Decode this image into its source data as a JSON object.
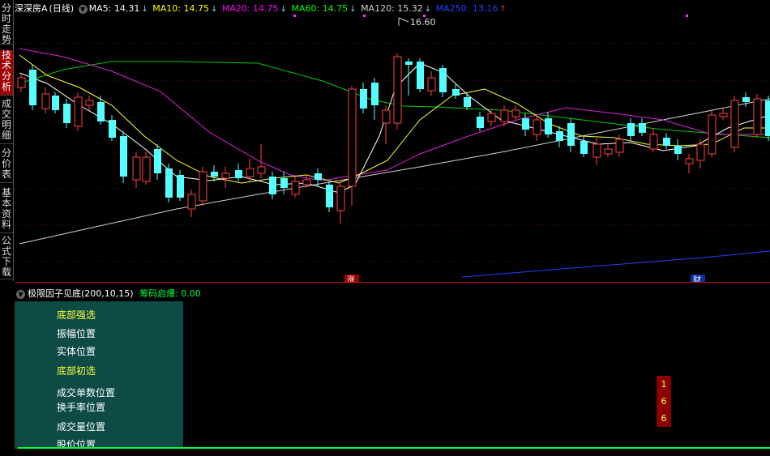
{
  "sidebar": {
    "tabs": [
      {
        "label": "分时走势",
        "active": false
      },
      {
        "label": "技术分析",
        "active": true
      },
      {
        "label": "成交明细",
        "active": false
      },
      {
        "label": "分价表",
        "active": false
      },
      {
        "label": "基本资料",
        "active": false
      },
      {
        "label": "公式下载",
        "active": false
      }
    ]
  },
  "header": {
    "stock": "深深房A",
    "period": "(日线)",
    "ma5": "MA5: 14.31",
    "ma10": "MA10: 14.75",
    "ma20": "MA20: 14.75",
    "ma60": "MA60: 14.75",
    "ma120": "MA120: 15.32",
    "ma250": "MA250: 13.16",
    "colors": {
      "ma5": "#ffffff",
      "ma10": "#ffff00",
      "ma20": "#ff00ff",
      "ma60": "#00ff00",
      "ma120": "#d0d0d0",
      "ma250": "#2040ff",
      "up_arrow": "#ff3030",
      "down_arrow": "#7fd4ff"
    }
  },
  "chart": {
    "high_label": "16.60",
    "marker_zhang": "涨",
    "marker_cai": "财"
  },
  "indicator": {
    "title": "极限因子见底(200,10,15)",
    "value_label": "筹码启爆: 0.00",
    "items": [
      {
        "label": "底部强选",
        "highlight": true
      },
      {
        "label": "振幅位置",
        "highlight": false
      },
      {
        "label": "实体位置",
        "highlight": false
      },
      {
        "label": "底部初选",
        "highlight": true
      },
      {
        "label": "成交单数位置",
        "highlight": false
      },
      {
        "label": "换手率位置",
        "highlight": false
      },
      {
        "label": "成交量位置",
        "highlight": false
      },
      {
        "label": "股价位置",
        "highlight": false
      }
    ],
    "badges": [
      "1",
      "6",
      "6"
    ]
  }
}
